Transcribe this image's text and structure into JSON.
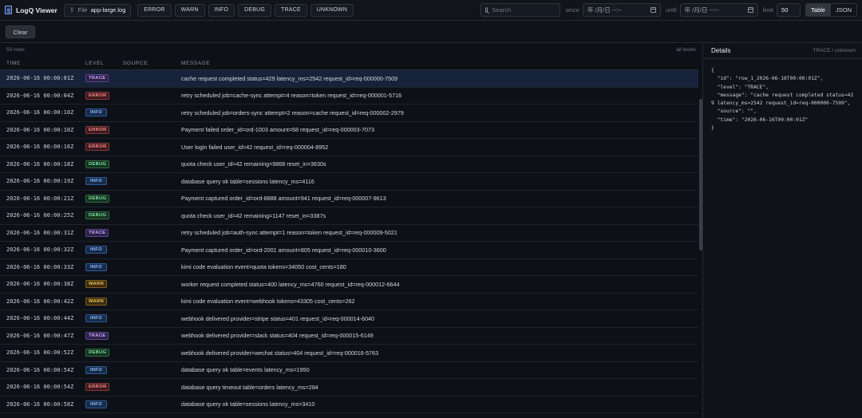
{
  "app": {
    "title": "LogQ Viewer"
  },
  "toolbar": {
    "file_label": "File",
    "file_name": "app-large.log",
    "levels": [
      "ERROR",
      "WARN",
      "INFO",
      "DEBUG",
      "TRACE",
      "UNKNOWN"
    ],
    "search_placeholder": "Search",
    "since_label": "since",
    "since_value": "年 /月/日 --:--",
    "until_label": "until",
    "until_value": "年 /月/日 --:--",
    "limit_label": "limit",
    "limit_value": "50",
    "view_table": "Table",
    "view_json": "JSON",
    "clear_label": "Clear"
  },
  "table": {
    "row_count": "50 rows",
    "filter_note": "all levels",
    "headers": {
      "time": "TIME",
      "level": "LEVEL",
      "source": "SOURCE",
      "message": "MESSAGE"
    },
    "rows": [
      {
        "time": "2026-06-16 00:00:01Z",
        "level": "TRACE",
        "message": "cache request completed status=429 latency_ms=2542 request_id=req-000000-7509"
      },
      {
        "time": "2026-06-16 00:00:04Z",
        "level": "ERROR",
        "message": "retry scheduled job=cache-sync attempt=4 reason=token request_id=req-000001-5716"
      },
      {
        "time": "2026-06-16 00:00:10Z",
        "level": "INFO",
        "message": "retry scheduled job=orders-sync attempt=2 reason=cache request_id=req-000002-2979"
      },
      {
        "time": "2026-06-16 00:00:10Z",
        "level": "ERROR",
        "message": "Payment failed order_id=ord-1003 amount=68 request_id=req-000003-7073"
      },
      {
        "time": "2026-06-16 00:00:16Z",
        "level": "ERROR",
        "message": "User login failed user_id=42 request_id=req-000004-8952"
      },
      {
        "time": "2026-06-16 00:00:18Z",
        "level": "DEBUG",
        "message": "quota check user_id=42 remaining=9868 reset_in=3630s"
      },
      {
        "time": "2026-06-16 00:00:19Z",
        "level": "INFO",
        "message": "database query ok table=sessions latency_ms=4116"
      },
      {
        "time": "2026-06-16 00:00:21Z",
        "level": "DEBUG",
        "message": "Payment captured order_id=ord-8888 amount=941 request_id=req-000007-9613"
      },
      {
        "time": "2026-06-16 00:00:25Z",
        "level": "DEBUG",
        "message": "quota check user_id=42 remaining=1147 reset_in=3387s"
      },
      {
        "time": "2026-06-16 00:00:31Z",
        "level": "TRACE",
        "message": "retry scheduled job=auth-sync attempt=1 reason=token request_id=req-000009-5021"
      },
      {
        "time": "2026-06-16 00:00:32Z",
        "level": "INFO",
        "message": "Payment captured order_id=ord-2001 amount=805 request_id=req-000010-3600"
      },
      {
        "time": "2026-06-16 00:00:33Z",
        "level": "INFO",
        "message": "kimi code evaluation event=quota tokens=34050 cost_cents=180"
      },
      {
        "time": "2026-06-16 00:00:38Z",
        "level": "WARN",
        "message": "worker request completed status=400 latency_ms=4760 request_id=req-000012-6644"
      },
      {
        "time": "2026-06-16 00:00:42Z",
        "level": "WARN",
        "message": "kimi code evaluation event=webhook tokens=43305 cost_cents=262"
      },
      {
        "time": "2026-06-16 00:00:44Z",
        "level": "INFO",
        "message": "webhook delivered provider=stripe status=401 request_id=req-000014-6040"
      },
      {
        "time": "2026-06-16 00:00:47Z",
        "level": "TRACE",
        "message": "webhook delivered provider=slack status=404 request_id=req-000015-6149"
      },
      {
        "time": "2026-06-16 00:00:52Z",
        "level": "DEBUG",
        "message": "webhook delivered provider=wechat status=404 request_id=req-000016-5763"
      },
      {
        "time": "2026-06-16 00:00:54Z",
        "level": "INFO",
        "message": "database query ok table=events latency_ms=1950"
      },
      {
        "time": "2026-06-16 00:00:54Z",
        "level": "ERROR",
        "message": "database query timeout table=orders latency_ms=284"
      },
      {
        "time": "2026-06-16 00:00:58Z",
        "level": "INFO",
        "message": "database query ok table=sessions latency_ms=3410"
      }
    ]
  },
  "details": {
    "title": "Details",
    "subtitle": "TRACE / unknown",
    "json_text": "{\n  \"id\": \"row_1_2026-06-16T00:00:01Z\",\n  \"level\": \"TRACE\",\n  \"message\": \"cache request completed status=429 latency_ms=2542 request_id=req-000000-7509\",\n  \"source\": \"\",\n  \"time\": \"2026-06-16T00:00:01Z\"\n}"
  }
}
